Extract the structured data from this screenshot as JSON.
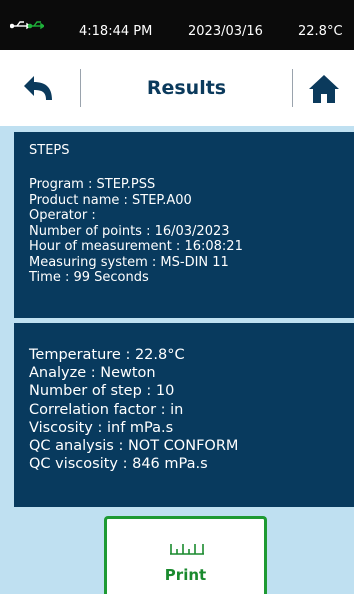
{
  "status_bar": {
    "time": "4:18:44 PM",
    "date": "2023/03/16",
    "temperature": "22.8°C",
    "usb_icon": "usb-icon",
    "usb_color": "#1fb23a"
  },
  "header": {
    "title": "Results",
    "back_icon": "back-arrow-icon",
    "home_icon": "home-icon"
  },
  "info_panel": {
    "heading": "STEPS",
    "lines": [
      "Program : STEP.PSS",
      "Product name : STEP.A00",
      "Operator :",
      "Number of points : 16/03/2023",
      "Hour of measurement : 16:08:21",
      "Measuring system : MS-DIN 11",
      "Time : 99 Seconds"
    ]
  },
  "results_panel": {
    "lines": [
      "Temperature : 22.8°C",
      "Analyze : Newton",
      "Number of step : 10",
      "Correlation factor : in",
      "Viscosity : inf mPa.s",
      "QC analysis : NOT CONFORM",
      "QC viscosity : 846 mPa.s"
    ]
  },
  "print_button": {
    "label": "Print",
    "icon": "ruler-icon"
  },
  "colors": {
    "panel_bg": "#083a5e",
    "content_bg": "#bfe0f1",
    "title": "#0b3a5c",
    "print_green": "#1e9a33"
  }
}
